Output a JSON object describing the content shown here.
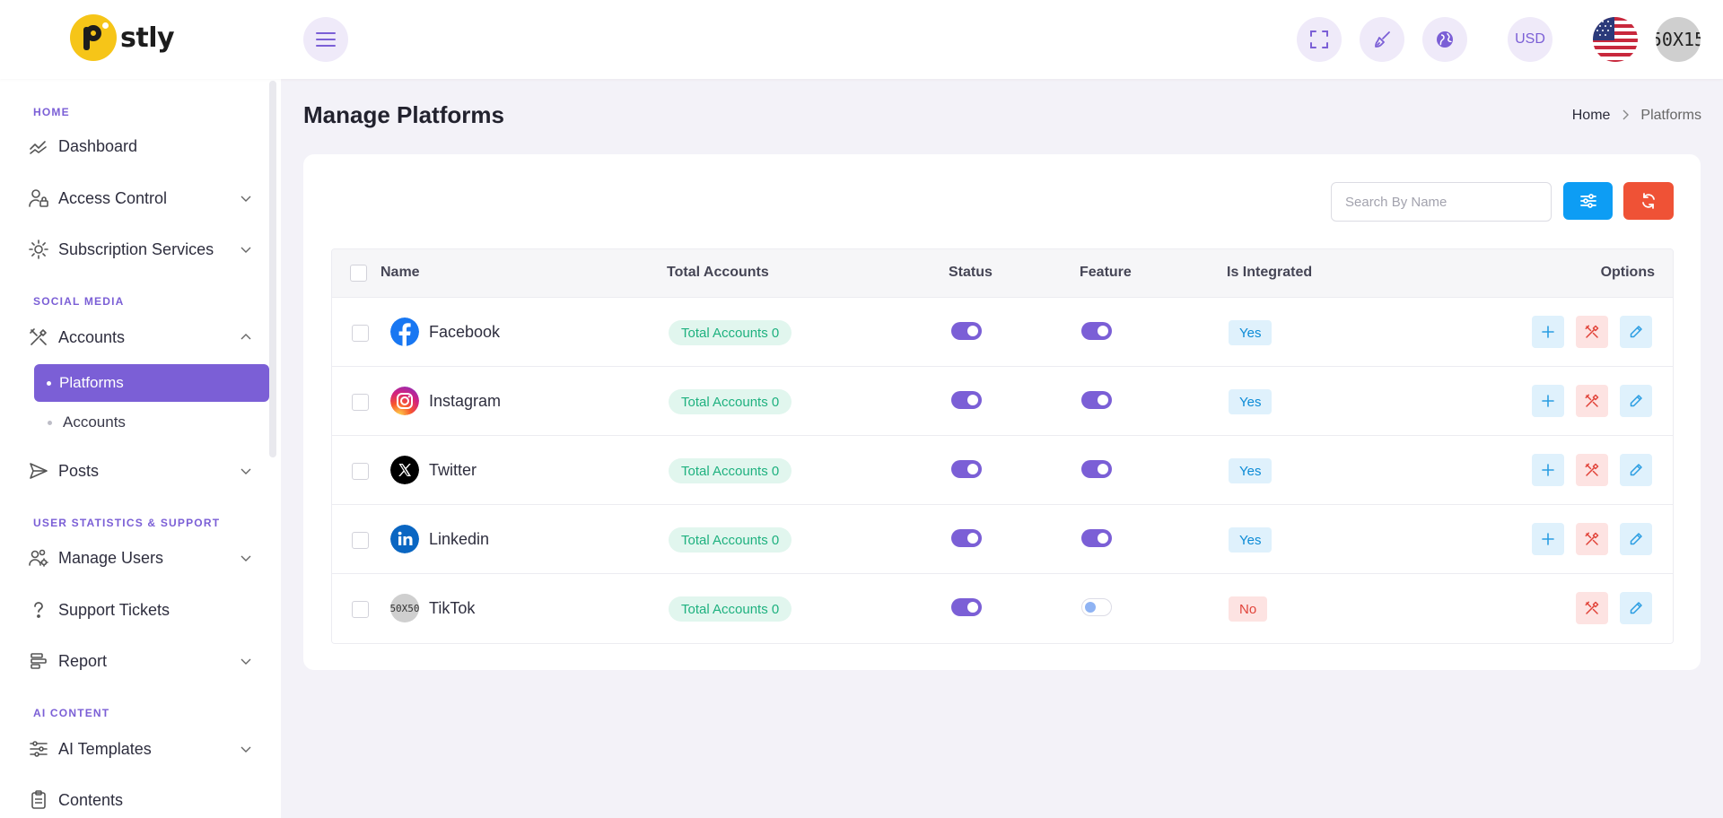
{
  "brand": {
    "name": "stly"
  },
  "header": {
    "currency": "USD",
    "avatar_text": "50X15",
    "icons": [
      "menu-icon",
      "fullscreen-icon",
      "brush-icon",
      "globe-icon",
      "flag-us-icon"
    ]
  },
  "sidebar": {
    "sections": {
      "home": "HOME",
      "social": "SOCIAL MEDIA",
      "stats": "USER STATISTICS & SUPPORT",
      "ai": "AI CONTENT"
    },
    "items": {
      "dashboard": "Dashboard",
      "access_control": "Access Control",
      "subscription": "Subscription Services",
      "accounts": "Accounts",
      "platforms": "Platforms",
      "accounts_sub": "Accounts",
      "posts": "Posts",
      "manage_users": "Manage Users",
      "support_tickets": "Support Tickets",
      "report": "Report",
      "ai_templates": "AI Templates",
      "contents": "Contents"
    }
  },
  "page": {
    "title": "Manage Platforms",
    "breadcrumb": {
      "home": "Home",
      "current": "Platforms"
    }
  },
  "toolbar": {
    "search_placeholder": "Search By Name"
  },
  "table": {
    "headers": {
      "name": "Name",
      "total_accounts": "Total Accounts",
      "status": "Status",
      "feature": "Feature",
      "integrated": "Is Integrated",
      "options": "Options"
    },
    "rows": [
      {
        "name": "Facebook",
        "icon": "facebook-icon",
        "total_accounts": "Total Accounts 0",
        "status": true,
        "feature": true,
        "integrated": "Yes",
        "can_add": true
      },
      {
        "name": "Instagram",
        "icon": "instagram-icon",
        "total_accounts": "Total Accounts 0",
        "status": true,
        "feature": true,
        "integrated": "Yes",
        "can_add": true
      },
      {
        "name": "Twitter",
        "icon": "x-twitter-icon",
        "total_accounts": "Total Accounts 0",
        "status": true,
        "feature": true,
        "integrated": "Yes",
        "can_add": true
      },
      {
        "name": "Linkedin",
        "icon": "linkedin-icon",
        "total_accounts": "Total Accounts 0",
        "status": true,
        "feature": true,
        "integrated": "Yes",
        "can_add": true
      },
      {
        "name": "TikTok",
        "icon": "placeholder-image",
        "icon_text": "50X50",
        "total_accounts": "Total Accounts 0",
        "status": true,
        "feature": false,
        "integrated": "No",
        "can_add": false
      }
    ]
  },
  "colors": {
    "accent": "#7b5fd6",
    "info": "#0d9df4",
    "danger": "#ef5236",
    "success": "#1eb17f",
    "brand_yellow": "#f6c518"
  }
}
